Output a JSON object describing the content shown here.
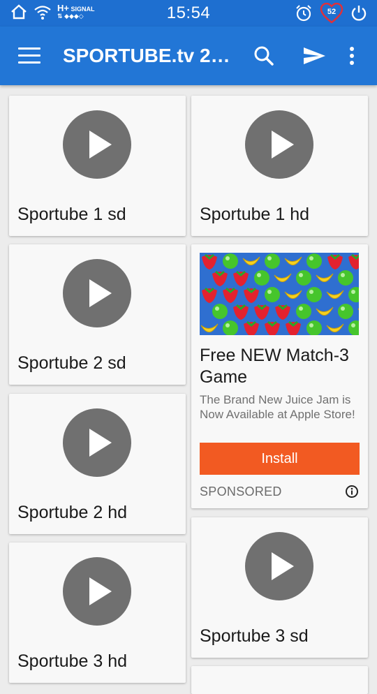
{
  "status_bar": {
    "network_label": "H+",
    "signal_label": "SIGNAL",
    "time": "15:54",
    "battery_percent": "52"
  },
  "app_bar": {
    "title": "SPORTUBE.tv 20...",
    "icons": [
      "menu-icon",
      "search-icon",
      "send-icon",
      "more-vert-icon"
    ]
  },
  "channels": [
    {
      "label": "Sportube 1 sd"
    },
    {
      "label": "Sportube 1 hd"
    },
    {
      "label": "Sportube 2 sd"
    },
    {
      "label": "Sportube 2 hd"
    },
    {
      "label": "Sportube 3 sd"
    },
    {
      "label": "Sportube 3 hd"
    }
  ],
  "ad": {
    "title": "Free NEW Match-3 Game",
    "description": "The Brand New Juice Jam is Now Available at Apple Store!",
    "install_label": "Install",
    "sponsored_label": "SPONSORED"
  },
  "colors": {
    "status_bar": "#1e6fd0",
    "app_bar": "#2276d6",
    "play_circle": "#707070",
    "install_button": "#f25a22"
  }
}
